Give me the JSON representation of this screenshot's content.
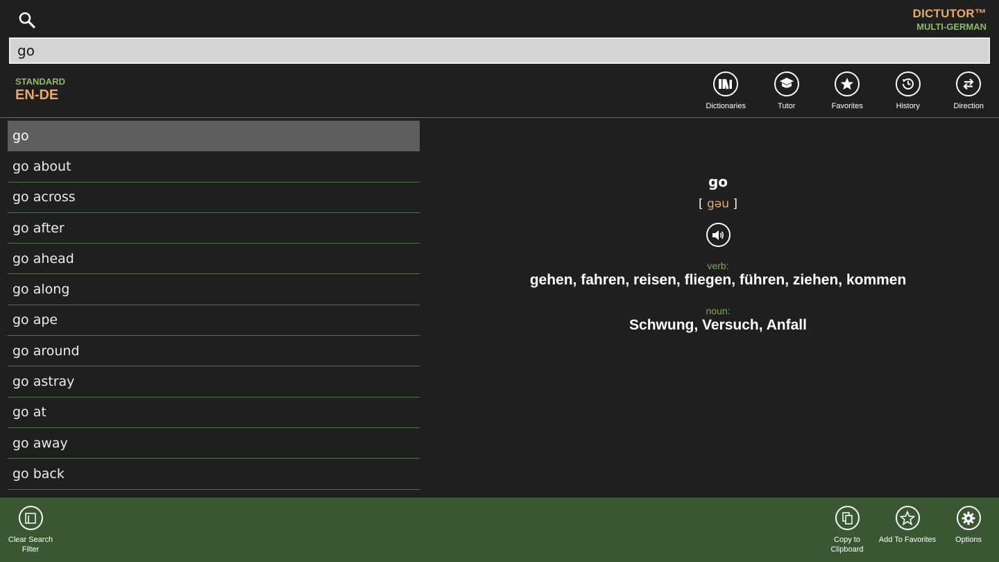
{
  "header": {
    "brand_name": "DICTUTOR™",
    "brand_subtitle": "MULTI-GERMAN",
    "search_icon": "search-icon"
  },
  "search": {
    "value": "go"
  },
  "dictionary": {
    "mode": "STANDARD",
    "pair": "EN-DE"
  },
  "toolbar": [
    {
      "label": "Dictionaries",
      "icon": "books-icon"
    },
    {
      "label": "Tutor",
      "icon": "graduation-cap-icon"
    },
    {
      "label": "Favorites",
      "icon": "star-icon"
    },
    {
      "label": "History",
      "icon": "clock-history-icon"
    },
    {
      "label": "Direction",
      "icon": "swap-arrows-icon"
    }
  ],
  "word_list": [
    "go",
    "go about",
    "go across",
    "go after",
    "go ahead",
    "go along",
    "go ape",
    "go around",
    "go astray",
    "go at",
    "go away",
    "go back"
  ],
  "selected_index": 0,
  "definition": {
    "word": "go",
    "pronunciation_open": "[",
    "pronunciation": "gəu",
    "pronunciation_close": "]",
    "audio_icon": "speaker-icon",
    "entries": [
      {
        "pos": "verb:",
        "translations": "gehen, fahren, reisen, fliegen, führen, ziehen, kommen"
      },
      {
        "pos": "noun:",
        "translations": "Schwung, Versuch, Anfall"
      }
    ]
  },
  "bottom_bar": {
    "clear_filter": "Clear Search\nFilter",
    "copy_clipboard": "Copy to\nClipboard",
    "add_favorites": "Add To Favorites",
    "options": "Options"
  },
  "colors": {
    "background": "#1f1f1f",
    "accent_orange": "#e8a96a",
    "accent_green": "#8fb86a",
    "bottom_bar": "#3a5733",
    "selected_row": "#5e5e5e"
  }
}
